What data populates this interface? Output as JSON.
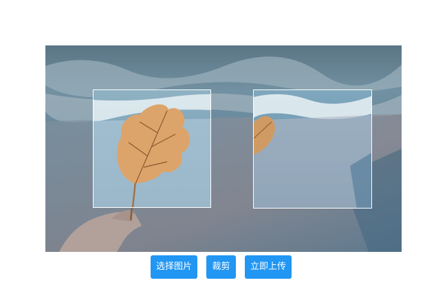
{
  "buttons": {
    "choose_image": "选择图片",
    "crop": "裁剪",
    "upload_now": "立即上传"
  },
  "colors": {
    "button_bg": "#2196f3",
    "button_text": "#ffffff",
    "crop_border": "#ffffff"
  }
}
